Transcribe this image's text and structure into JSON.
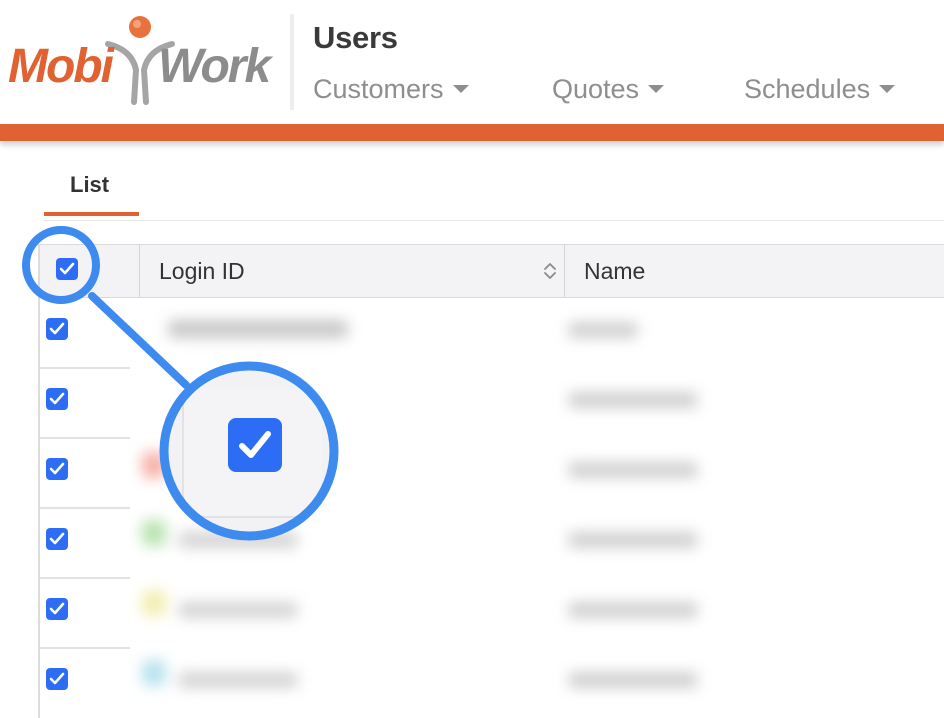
{
  "brand": {
    "logo_text_left": "Mobi",
    "logo_text_right": "Work",
    "accent_color": "#e06232",
    "checkbox_color": "#2d6df6",
    "callout_color": "#3d8bef"
  },
  "header": {
    "title": "Users",
    "nav": [
      {
        "label": "Customers"
      },
      {
        "label": "Quotes"
      },
      {
        "label": "Schedules"
      }
    ]
  },
  "tabs": [
    {
      "label": "List",
      "active": true
    }
  ],
  "table": {
    "columns": [
      {
        "label": "Login ID",
        "sortable": true
      },
      {
        "label": "Name"
      }
    ],
    "select_all_checked": true,
    "rows_checked": [
      true,
      true,
      true,
      true,
      true,
      true
    ]
  },
  "icons": {
    "checkbox": "check-icon",
    "sort": "sort-icon",
    "nav_caret": "caret-down-icon"
  }
}
